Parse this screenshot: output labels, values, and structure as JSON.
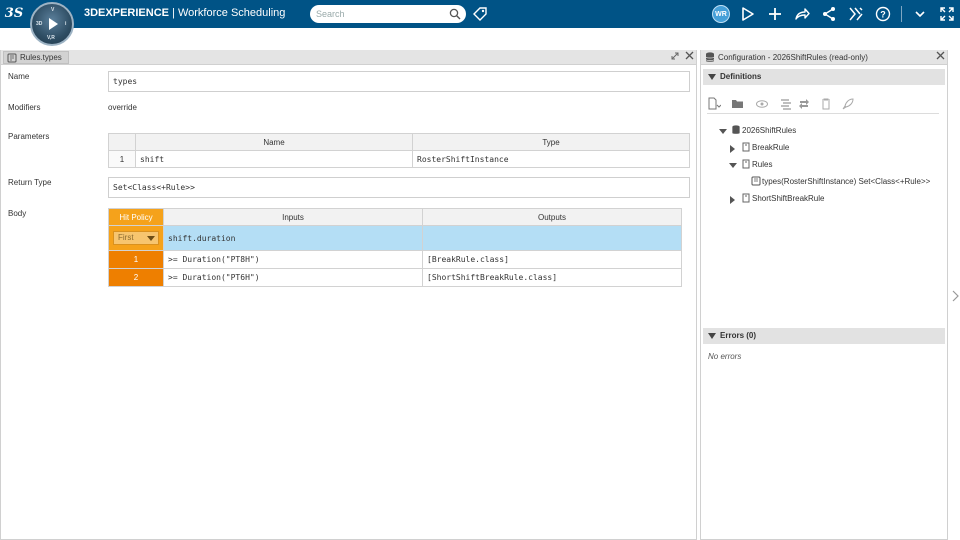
{
  "app": {
    "brand": "3DEXPERIENCE",
    "separator": " | ",
    "name": "Workforce Scheduling",
    "compass": {
      "top": "V",
      "left": "3D",
      "right": "i",
      "bottom": "V,R"
    }
  },
  "search": {
    "placeholder": "Search"
  },
  "user": {
    "initials": "WR"
  },
  "left_panel": {
    "tab_label": "Rules.types",
    "fields": {
      "name_label": "Name",
      "name_value": "types",
      "modifiers_label": "Modifiers",
      "modifiers_value": "override",
      "parameters_label": "Parameters",
      "return_type_label": "Return Type",
      "return_type_value": "Set<Class<+Rule>>",
      "body_label": "Body"
    },
    "parameters": {
      "headers": [
        "Name",
        "Type"
      ],
      "rows": [
        {
          "index": "1",
          "name": "shift",
          "type": "RosterShiftInstance"
        }
      ]
    },
    "decision_table": {
      "hit_policy_label": "Hit Policy",
      "inputs_label": "Inputs",
      "outputs_label": "Outputs",
      "hit_policy_value": "First",
      "input_expression": "shift.duration",
      "rows": [
        {
          "index": "1",
          "input": ">= Duration(\"PT8H\")",
          "output": "[BreakRule.class]"
        },
        {
          "index": "2",
          "input": ">= Duration(\"PT6H\")",
          "output": "[ShortShiftBreakRule.class]"
        }
      ]
    }
  },
  "right_panel": {
    "title": "Configuration - 2026ShiftRules (read-only)",
    "definitions_label": "Definitions",
    "tree": {
      "root": "2026ShiftRules",
      "break_rule": "BreakRule",
      "rules": "Rules",
      "rule_method": "types(RosterShiftInstance)  Set<Class<+Rule>>",
      "short_shift": "ShortShiftBreakRule"
    },
    "errors_label": "Errors (0)",
    "no_errors": "No errors"
  },
  "colors": {
    "topbar": "#005386",
    "hit_policy": "#f5a21b",
    "row_number": "#ee7f00",
    "input_header_row": "#b4def5"
  }
}
